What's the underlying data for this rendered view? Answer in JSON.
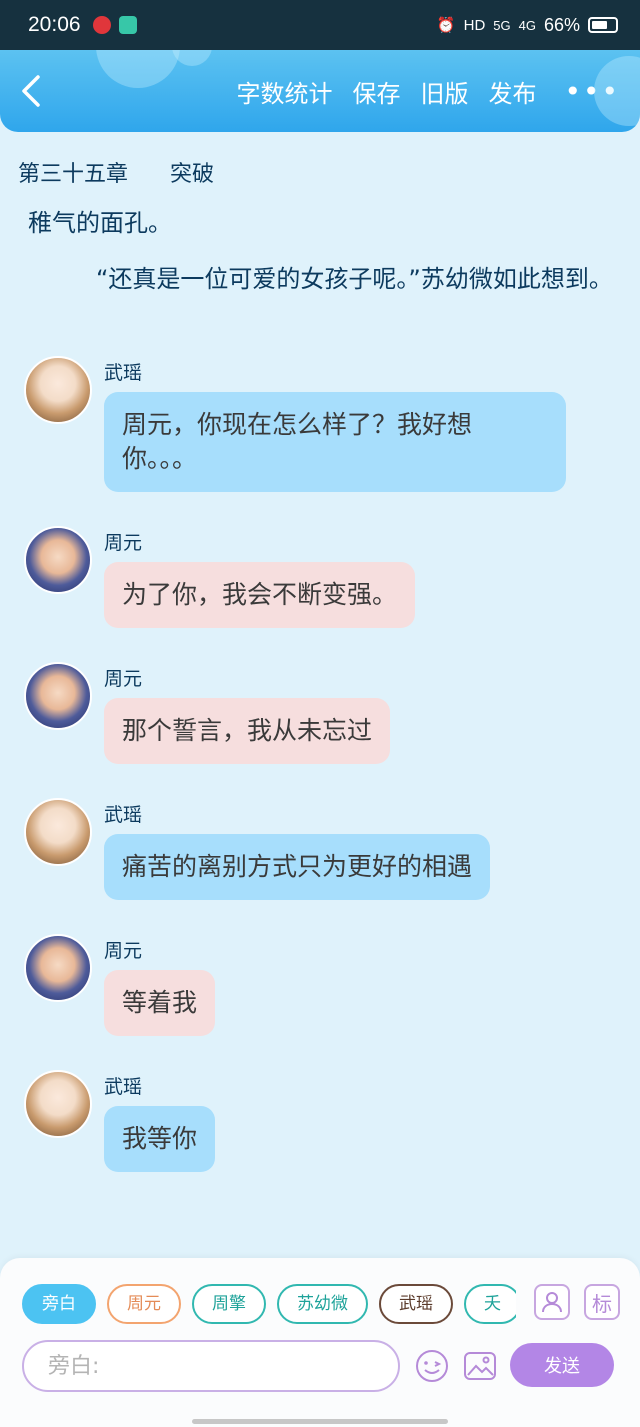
{
  "status": {
    "time": "20:06",
    "network": "HD",
    "signal_1": "5G",
    "signal_2": "4G",
    "battery": "66%",
    "battery_level": 0.66
  },
  "header": {
    "back_icon": "chevron-left-icon",
    "actions": [
      "字数统计",
      "保存",
      "旧版",
      "发布"
    ],
    "more_icon": "more-dots-icon",
    "more_label": "•••"
  },
  "chapter": {
    "number": "第三十五章",
    "title": "突破"
  },
  "narration": [
    "稚气的面孔。",
    "“还真是一位可爱的女孩子呢。”苏幼微如此想到。"
  ],
  "messages": [
    {
      "speaker": "武瑶",
      "text": "周元，你现在怎么样了？我好想你。。。",
      "style": "blue"
    },
    {
      "speaker": "周元",
      "text": "为了你，我会不断变强。",
      "style": "pink"
    },
    {
      "speaker": "周元",
      "text": "那个誓言，我从未忘过",
      "style": "pink"
    },
    {
      "speaker": "武瑶",
      "text": "痛苦的离别方式只为更好的相遇",
      "style": "blue"
    },
    {
      "speaker": "周元",
      "text": "等着我",
      "style": "pink"
    },
    {
      "speaker": "武瑶",
      "text": "我等你",
      "style": "blue"
    }
  ],
  "input_panel": {
    "chips": [
      "旁白",
      "周元",
      "周擎",
      "苏幼微",
      "武瑶",
      "夭"
    ],
    "active_chip": "旁白",
    "role_icon": "user-card-icon",
    "tag_label": "标",
    "placeholder": "旁白:",
    "emoji_icon": "emoji-icon",
    "image_icon": "image-icon",
    "send_label": "发送"
  },
  "colors": {
    "header": "#2fa6ec",
    "background": "#dff2fb",
    "bubble_blue": "#a7defc",
    "bubble_pink": "#f6dede",
    "send": "#b386e6"
  }
}
